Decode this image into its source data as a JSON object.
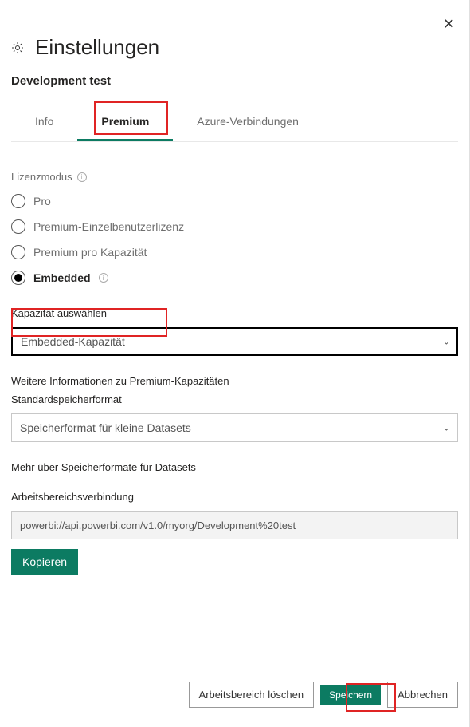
{
  "header": {
    "title": "Einstellungen",
    "subtitle": "Development test",
    "close": "✕"
  },
  "tabs": {
    "info": "Info",
    "premium": "Premium",
    "azure": "Azure-Verbindungen"
  },
  "license": {
    "label": "Lizenzmodus",
    "options": {
      "pro": "Pro",
      "ppu": "Premium-Einzelbenutzerlizenz",
      "ppc": "Premium pro Kapazität",
      "embedded": "Embedded"
    }
  },
  "capacity": {
    "label": "Kapazität auswählen",
    "value": "Embedded-Kapazität"
  },
  "premium_info": "Weitere Informationen zu Premium-Kapazitäten",
  "storage": {
    "label": "Standardspeicherformat",
    "value": "Speicherformat für kleine Datasets"
  },
  "storage_more": "Mehr über Speicherformate für Datasets",
  "connection": {
    "label": "Arbeitsbereichsverbindung",
    "value": "powerbi://api.powerbi.com/v1.0/myorg/Development%20test",
    "copy": "Kopieren"
  },
  "footer": {
    "delete": "Arbeitsbereich löschen",
    "save": "Speichern",
    "cancel": "Abbrechen"
  }
}
